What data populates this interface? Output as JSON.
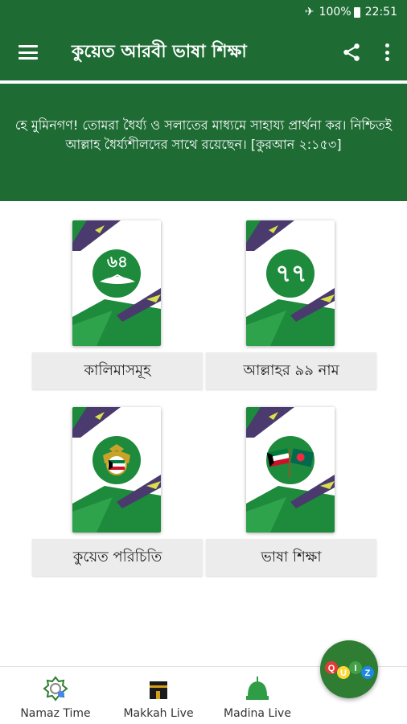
{
  "status_bar": {
    "battery": "100%",
    "time": "22:51"
  },
  "app_bar": {
    "title": "কুয়েত আরবী ভাষা শিক্ষা"
  },
  "banner": {
    "text": "হে মুমিনগণ! তোমরা ধৈর্য্য ও সলাতের মাধ্যমে সাহায্য প্রার্থনা কর। নিশ্চিতই আল্লাহ ধৈর্য্যশীলদের সাথে রয়েছেন। [কুরআন ২:১৫৩]"
  },
  "cards": [
    {
      "label": "কালিমাসমূহ",
      "icon": "kalima-icon",
      "badge": "৬৪"
    },
    {
      "label": "আল্লাহর ৯৯ নাম",
      "icon": "allah-99-names-icon",
      "badge": "৭৭"
    },
    {
      "label": "কুয়েত পরিচিতি",
      "icon": "kuwait-emblem-icon"
    },
    {
      "label": "ভাষা শিক্ষা",
      "icon": "flags-icon"
    }
  ],
  "bottom_nav": [
    {
      "label": "Namaz Time",
      "icon": "namaz-time-icon"
    },
    {
      "label": "Makkah Live",
      "icon": "kaaba-icon"
    },
    {
      "label": "Madina Live",
      "icon": "madina-dome-icon"
    }
  ],
  "quiz_fab": {
    "icon": "quiz-icon"
  },
  "colors": {
    "primary": "#1e6b34",
    "accent_green": "#2e9d45",
    "purple": "#4a3a6e",
    "yellow": "#d8e04a"
  }
}
